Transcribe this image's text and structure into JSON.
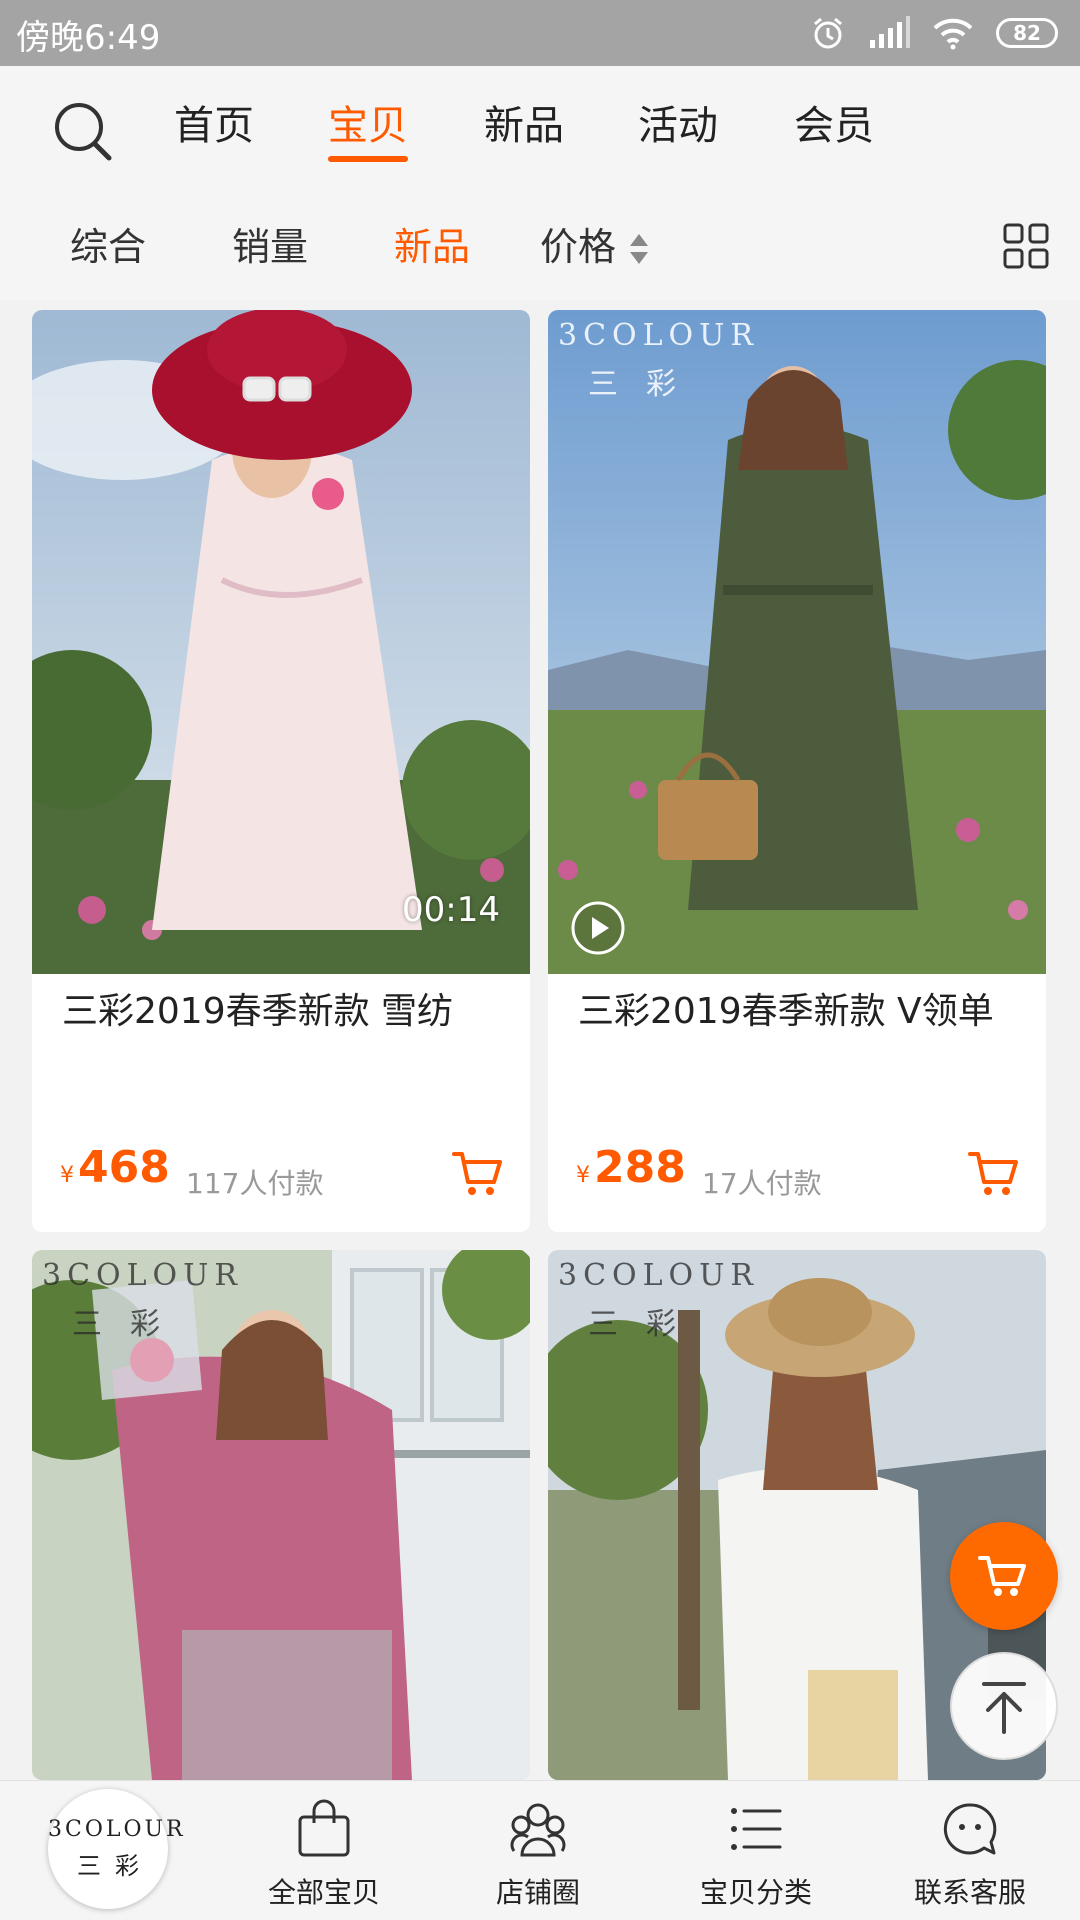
{
  "status_bar": {
    "time": "傍晚6:49",
    "battery": "82"
  },
  "top_nav": {
    "tabs": [
      "首页",
      "宝贝",
      "新品",
      "活动",
      "会员"
    ],
    "active_index": 1
  },
  "sort_bar": {
    "items": [
      "综合",
      "销量",
      "新品",
      "价格"
    ],
    "active_index": 2
  },
  "products": [
    {
      "title": "三彩2019春季新款 雪纺",
      "price": "468",
      "currency": "¥",
      "sold": "117人付款",
      "video_duration": "00:14"
    },
    {
      "title": "三彩2019春季新款 V领单",
      "price": "288",
      "currency": "¥",
      "sold": "17人付款",
      "brand_en": "3COLOUR",
      "brand_cn": "三彩"
    },
    {
      "brand_en": "3COLOUR",
      "brand_cn": "三彩"
    },
    {
      "brand_en": "3COLOUR",
      "brand_cn": "三彩"
    }
  ],
  "bottom_bar": {
    "shop_logo": {
      "en": "3COLOUR",
      "cn": "三彩"
    },
    "tabs": [
      "全部宝贝",
      "店铺圈",
      "宝贝分类",
      "联系客服"
    ]
  },
  "colors": {
    "accent": "#ff5a00",
    "status_bar": "#a4a4a4"
  }
}
